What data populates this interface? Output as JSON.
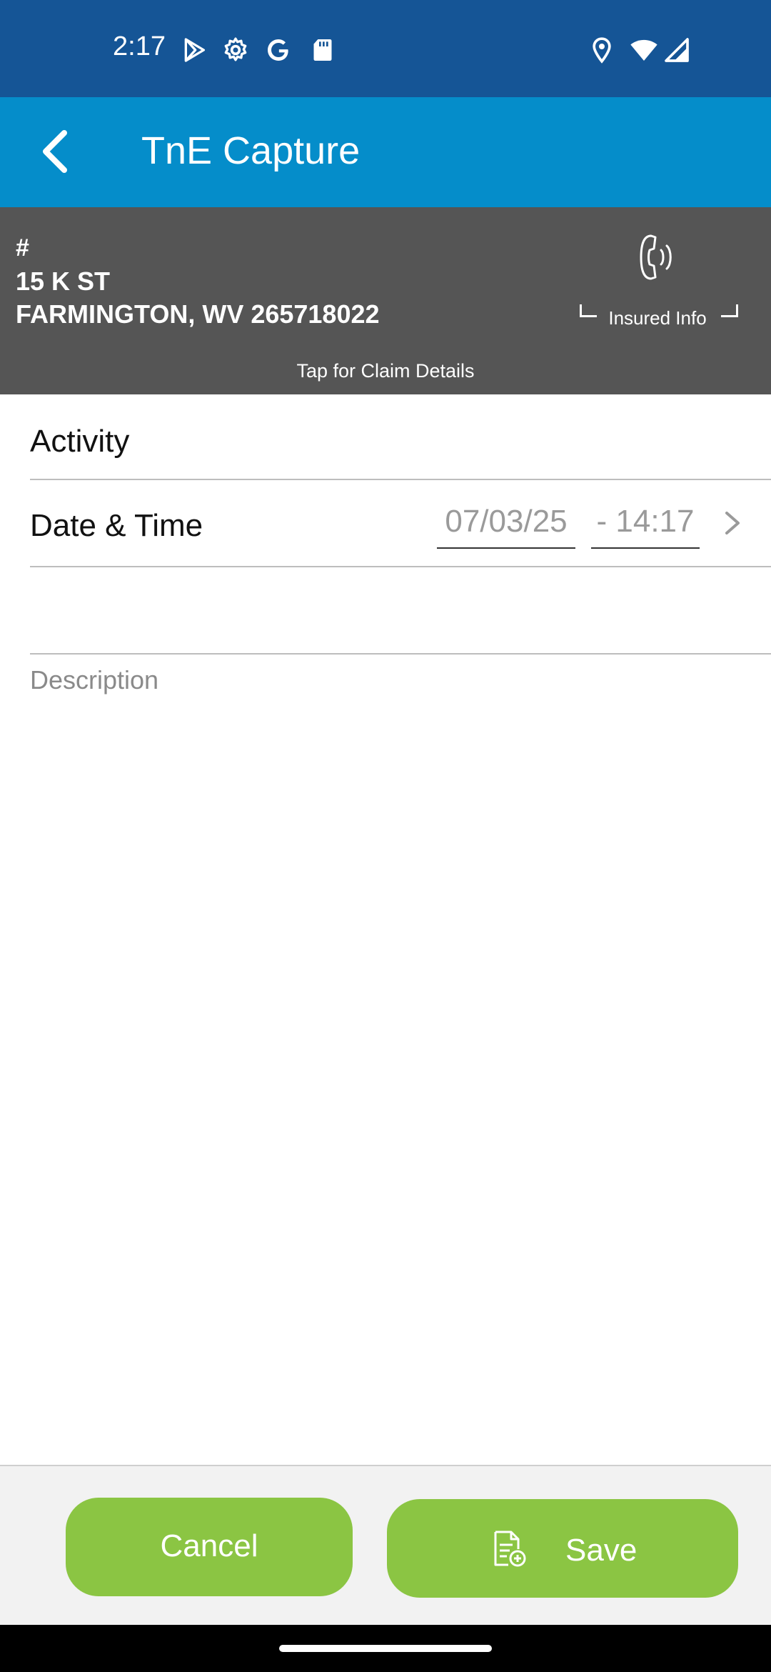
{
  "status_bar": {
    "time": "2:17",
    "left_icons": [
      "play-store-icon",
      "settings-icon",
      "google-icon",
      "sd-card-icon"
    ],
    "right_icons": [
      "location-icon",
      "wifi-icon",
      "signal-icon"
    ]
  },
  "app_bar": {
    "title": "TnE Capture",
    "back_icon": "chevron-left-icon",
    "background": "#058dca"
  },
  "claim": {
    "hash": "#",
    "address_line1": "15 K ST",
    "address_line2": "FARMINGTON, WV 265718022",
    "tap_hint": "Tap for Claim Details",
    "insured_info_label": "Insured Info",
    "insured_icon": "phone-ringing-icon",
    "background": "#555555"
  },
  "form": {
    "activity_label": "Activity",
    "datetime_label": "Date & Time",
    "date_value": "07/03/25",
    "time_value": "- 14:17",
    "description_placeholder": "Description"
  },
  "actions": {
    "cancel_label": "Cancel",
    "save_label": "Save",
    "save_icon": "document-add-icon",
    "button_color": "#8bc543"
  },
  "colors": {
    "status_bar": "#155596",
    "accent": "#058dca"
  }
}
